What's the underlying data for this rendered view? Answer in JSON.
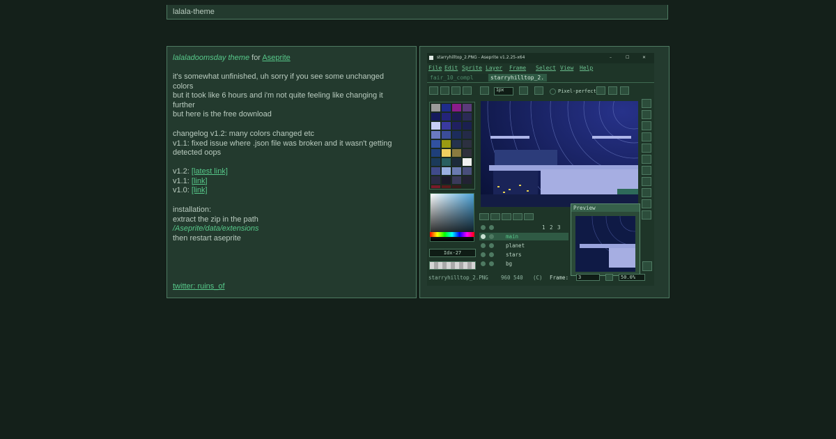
{
  "page": {
    "header_title": "lalala-theme"
  },
  "post": {
    "title_italic": "lalaladoomsday theme",
    "title_for": " for ",
    "title_link": "Aseprite",
    "para1": [
      "it's somewhat unfinished, uh sorry if you see some unchanged",
      "colors",
      "but it took like 6 hours and i'm not quite feeling like changing it",
      "further",
      "but here is the free download"
    ],
    "para2": [
      "changelog v1.2: many colors changed etc",
      "v1.1: fixed issue where .json file was broken and it wasn't getting",
      "detected oops"
    ],
    "versions": [
      {
        "label": "v1.2: ",
        "link": "[latest link]"
      },
      {
        "label": "v1.1: ",
        "link": "[link]"
      },
      {
        "label": "v1.0: ",
        "link": "[link]"
      }
    ],
    "install": {
      "heading": "installation:",
      "step1": "extract the zip in the path",
      "path": "/Aseprite/data/extensions",
      "step2": "then restart aseprite"
    },
    "twitter": "twitter: ruins_of"
  },
  "aseprite": {
    "window_title": "starryhilltop_2.PNG - Aseprite v1.2.25-x64",
    "window_buttons": [
      "–",
      "☐",
      "✕"
    ],
    "menu": [
      "File",
      "Edit",
      "Sprite",
      "Layer",
      "Frame",
      "Select",
      "View",
      "Help"
    ],
    "tabs": [
      "fair_10_compl",
      "starryhilltop_2."
    ],
    "brush_size": "1px",
    "pixel_perfect": "Pixel-perfect",
    "color_index": "Idx-27",
    "layers": [
      "main",
      "planet",
      "stars",
      "bg"
    ],
    "frame_numbers": [
      "1",
      "2",
      "3"
    ],
    "preview_title": "Preview",
    "status": {
      "file": "starryhilltop_2.PNG",
      "size": "960 540",
      "mode": "(C)",
      "frame_label": "Frame:",
      "frame_value": "3",
      "zoom": "50.0%"
    },
    "colors": {
      "panel": "#233a2e",
      "border": "#4e7a62",
      "accent": "#57c88a",
      "canvas_sky": "#0d1640"
    },
    "icons": [
      "window-app-icon",
      "minimize-icon",
      "maximize-icon",
      "close-icon",
      "eye-icon",
      "lock-icon",
      "play-icon"
    ]
  }
}
